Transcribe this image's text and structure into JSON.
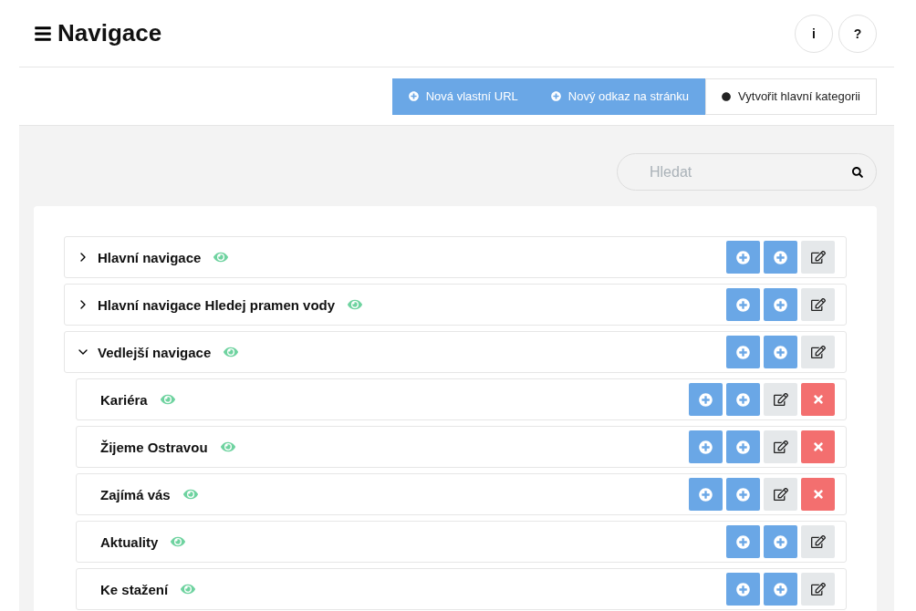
{
  "header": {
    "title": "Navigace",
    "buttons": [
      "i",
      "?"
    ]
  },
  "toolbar": [
    {
      "label": "Nová vlastní URL",
      "kind": "primary"
    },
    {
      "label": "Nový odkaz na stránku",
      "kind": "primary"
    },
    {
      "label": "Vytvořit hlavní kategorii",
      "kind": "plain"
    }
  ],
  "search": {
    "placeholder": "Hledat"
  },
  "tree": [
    {
      "label": "Hlavní navigace",
      "visible": true,
      "expanded": false,
      "deletable": false
    },
    {
      "label": "Hlavní navigace Hledej pramen vody",
      "visible": true,
      "expanded": false,
      "deletable": false
    },
    {
      "label": "Vedlejší navigace",
      "visible": true,
      "expanded": true,
      "deletable": false,
      "children": [
        {
          "label": "Kariéra",
          "visible": true,
          "deletable": true
        },
        {
          "label": "Žijeme Ostravou",
          "visible": true,
          "deletable": true
        },
        {
          "label": "Zajímá vás",
          "visible": true,
          "deletable": true
        },
        {
          "label": "Aktuality",
          "visible": true,
          "deletable": false
        },
        {
          "label": "Ke stažení",
          "visible": true,
          "deletable": false
        }
      ]
    }
  ]
}
